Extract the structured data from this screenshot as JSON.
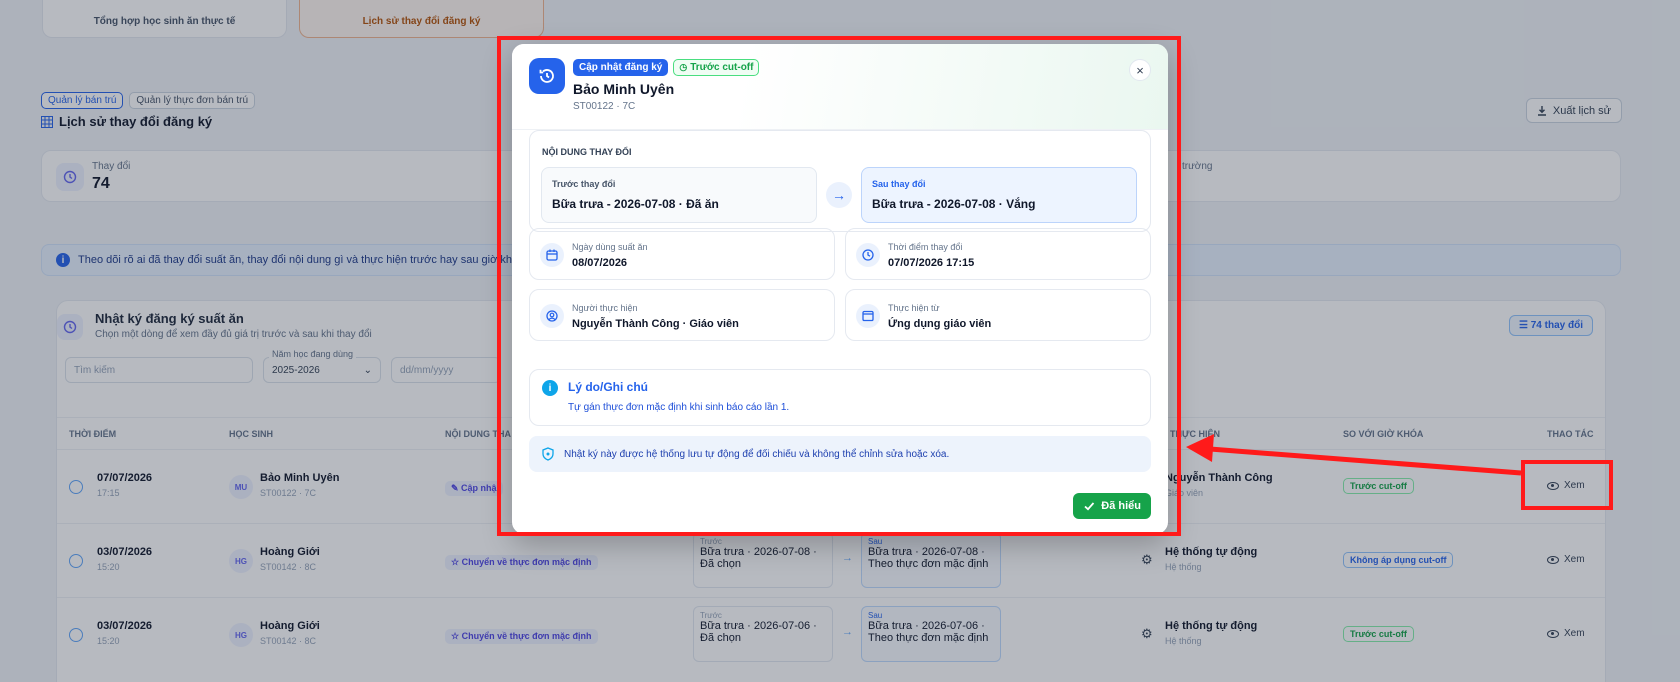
{
  "top_cards": [
    "Tổng hợp học sinh ăn thực tế",
    "Lịch sử thay đổi đăng ký"
  ],
  "crumbs": [
    "Quản lý bán trú",
    "Quản lý thực đơn bán trú"
  ],
  "page_title": "Lịch sử thay đổi đăng ký",
  "export_label": "Xuất lịch sử",
  "stat": {
    "label": "Thay đổi",
    "value": "74",
    "label2": "trường"
  },
  "info_banner": "Theo dõi rõ ai đã thay đổi suất ăn, thay đổi nội dung gì và thực hiện trước hay sau giờ khóa",
  "log": {
    "title": "Nhật ký đăng ký suất ăn",
    "subtitle": "Chọn một dòng để xem đầy đủ giá trị trước và sau khi thay đổi",
    "count": "74 thay đổi",
    "search_placeholder": "Tìm kiếm",
    "year_label": "Năm học đang dùng",
    "year_value": "2025-2026",
    "date_placeholder": "dd/mm/yyyy"
  },
  "table": {
    "headers": [
      "THỜI ĐIỂM",
      "HỌC SINH",
      "NỘI DUNG THA",
      "I THỰC HIỆN",
      "SO VỚI GIỜ KHÓA",
      "THAO TÁC"
    ],
    "rows": [
      {
        "date": "07/07/2026",
        "time": "17:15",
        "initials": "MU",
        "student": "Bảo Minh Uyên",
        "code": "ST00122 · 7C",
        "tag": "Cập nhậ",
        "before_cap": "",
        "before": "",
        "after_cap": "",
        "after": "",
        "exec": "Nguyễn Thành Công",
        "exec_sub": "Giáo viên",
        "cut": "Trước cut-off",
        "action": "Xem"
      },
      {
        "date": "03/07/2026",
        "time": "15:20",
        "initials": "HG",
        "student": "Hoàng Giới",
        "code": "ST00142 · 8C",
        "tag": "Chuyển về thực đơn mặc định",
        "before_cap": "Trước",
        "before": "Bữa trưa · 2026-07-08 · Đã chọn",
        "after_cap": "Sau",
        "after": "Bữa trưa · 2026-07-08 · Theo thực đơn mặc định",
        "exec": "Hệ thống tự động",
        "exec_sub": "Hệ thống",
        "cut": "Không áp dụng cut-off",
        "action": "Xem"
      },
      {
        "date": "03/07/2026",
        "time": "15:20",
        "initials": "HG",
        "student": "Hoàng Giới",
        "code": "ST00142 · 8C",
        "tag": "Chuyển về thực đơn mặc định",
        "before_cap": "Trước",
        "before": "Bữa trưa · 2026-07-06 · Đã chọn",
        "after_cap": "Sau",
        "after": "Bữa trưa · 2026-07-06 · Theo thực đơn mặc định",
        "exec": "Hệ thống tự động",
        "exec_sub": "Hệ thống",
        "cut": "Trước cut-off",
        "action": "Xem"
      }
    ]
  },
  "modal": {
    "tag_update": "Cập nhật đăng ký",
    "tag_cutoff": "Trước cut-off",
    "student_name": "Bảo Minh Uyên",
    "student_code": "ST00122 · 7C",
    "close": "×",
    "change_title": "NỘI DUNG THAY ĐỔI",
    "before_caption": "Trước thay đổi",
    "before_value": "Bữa trưa - 2026-07-08 · Đã ăn",
    "after_caption": "Sau thay đổi",
    "after_value": "Bữa trưa - 2026-07-08 · Vắng",
    "meal_date_label": "Ngày dùng suất ăn",
    "meal_date_value": "08/07/2026",
    "changed_at_label": "Thời điểm thay đổi",
    "changed_at_value": "07/07/2026 17:15",
    "actor_label": "Người thực hiện",
    "actor_value": "Nguyễn Thành Công · Giáo viên",
    "source_label": "Thực hiện từ",
    "source_value": "Ứng dụng giáo viên",
    "reason_title": "Lý do/Ghi chú",
    "reason_text": "Tự gán thực đơn mặc định khi sinh báo cáo lần 1.",
    "notice": "Nhật ký này được hệ thống lưu tự động để đối chiếu và không thể chỉnh sửa hoặc xóa.",
    "ok_label": "Đã hiểu"
  },
  "colors": {
    "primary": "#2563eb",
    "success": "#16a34a",
    "annotation": "#ff1a1a"
  }
}
